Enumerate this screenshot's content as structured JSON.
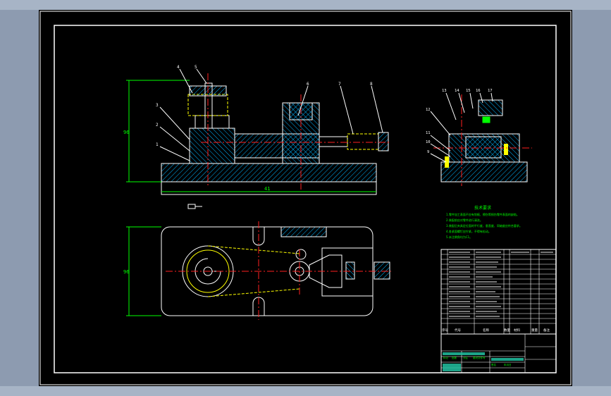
{
  "drawing": {
    "colors": {
      "background": "#000000",
      "outline": "#ffffff",
      "hatch": "#00b4ff",
      "centerline": "#ff2020",
      "hidden": "#ffff00",
      "dimension": "#00ff00",
      "leader": "#ffffff",
      "text_green": "#00ff00",
      "part_fill": "#22c1a1"
    },
    "front_view": {
      "balloons": [
        "4",
        "5",
        "6",
        "7",
        "8",
        "3",
        "2",
        "1"
      ],
      "dimension_height": "96",
      "dimension_width": "41"
    },
    "side_view": {
      "balloons": [
        "13",
        "14",
        "15",
        "16",
        "17",
        "12",
        "11",
        "10",
        "9"
      ]
    },
    "top_view": {
      "dimension_height": "96"
    },
    "technical_requirements": {
      "title": "技术要求",
      "lines": [
        "1.零件加工表面不应有划痕、擦伤等损伤零件表面的缺陷。",
        "2.装配前应对零件进行清洗。",
        "3.装配后夹具定位面的平行度、垂直度、同轴度应符合要求。",
        "4.各紧固螺钉应拧紧，不得有松动。",
        "5.未注倒角均为C1。"
      ]
    },
    "parts_list": {
      "header": [
        "序号",
        "代号",
        "名称",
        "数量",
        "材料",
        "重量",
        "备注"
      ]
    },
    "title_block": {
      "labels": [
        "标记",
        "处数",
        "分区",
        "更改文件号",
        "签名",
        "年月日"
      ]
    }
  }
}
